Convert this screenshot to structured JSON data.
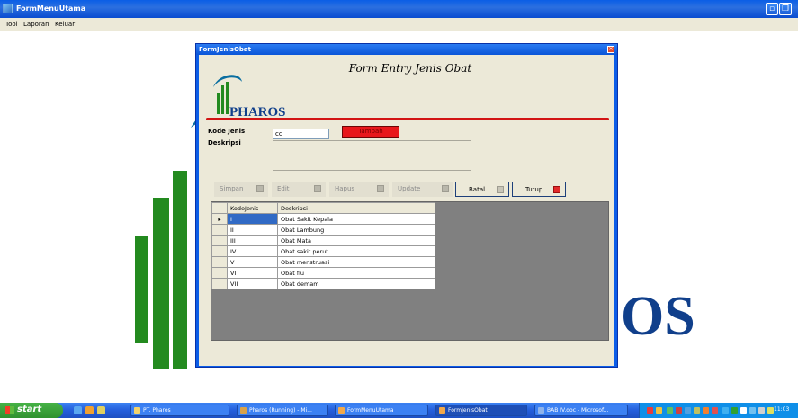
{
  "window": {
    "title": "FormMenuUtama"
  },
  "menubar": {
    "items": [
      "Tool",
      "Laporan",
      "Keluar"
    ]
  },
  "background": {
    "logo_text": "OS"
  },
  "child_window": {
    "title": "FormJenisObat",
    "heading": "Form Entry Jenis Obat",
    "company_name": "PHAROS",
    "kode_label": "Kode Jenis",
    "deskripsi_label": "Deskripsi",
    "kode_value": "cc",
    "tambah_label": "Tambah",
    "buttons": [
      "Simpan",
      "Edit",
      "Hapus",
      "Update",
      "Batal",
      "Tutup"
    ],
    "grid": {
      "columns": [
        "KodeJenis",
        "Deskripsi"
      ],
      "rows": [
        [
          "I",
          "Obat Sakit Kepala"
        ],
        [
          "II",
          "Obat Lambung"
        ],
        [
          "III",
          "Obat Mata"
        ],
        [
          "IV",
          "Obat sakit perut"
        ],
        [
          "V",
          "Obat menstruasi"
        ],
        [
          "VI",
          "Obat flu"
        ],
        [
          "VII",
          "Obat demam"
        ]
      ]
    }
  },
  "taskbar": {
    "start_label": "start",
    "buttons": [
      "PT. Pharos",
      "Pharos (Running) - Mi...",
      "FormMenuUtama",
      "FormJenisObat",
      "BAB IV.doc - Microsof..."
    ],
    "clock": "11:03"
  },
  "colors": {
    "titlebar": "#0a5ee6",
    "accent_red": "#d21414",
    "brand_blue": "#103f8b",
    "selection": "#316ac5"
  }
}
